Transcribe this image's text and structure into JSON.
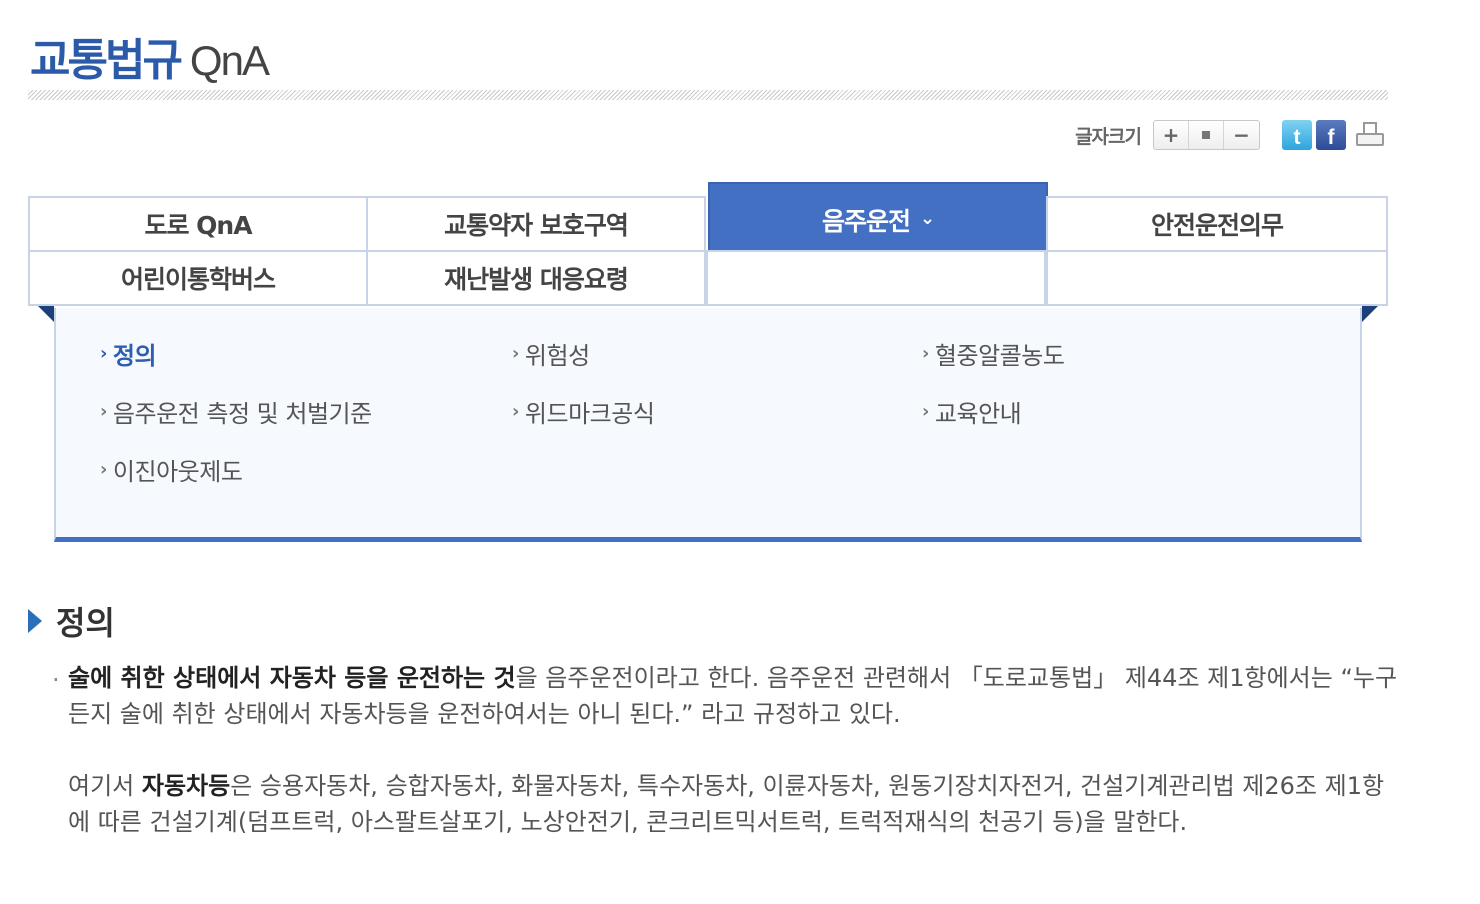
{
  "page": {
    "title_ko": "교통법규",
    "title_en": "QnA"
  },
  "tools": {
    "font_size_label": "글자크기",
    "font_plus": "+",
    "font_minus": "−",
    "twitter_glyph": "t",
    "facebook_glyph": "f",
    "icons": [
      "plus-icon",
      "reset-icon",
      "minus-icon",
      "twitter-icon",
      "facebook-icon",
      "print-icon"
    ]
  },
  "tabs": [
    {
      "label": "도로 QnA",
      "active": false
    },
    {
      "label": "교통약자 보호구역",
      "active": false
    },
    {
      "label": "음주운전",
      "active": true
    },
    {
      "label": "안전운전의무",
      "active": false
    },
    {
      "label": "어린이통학버스",
      "active": false
    },
    {
      "label": "재난발생 대응요령",
      "active": false
    }
  ],
  "active_tab_chevron": "⌄",
  "submenu": {
    "arrow": "›",
    "items": [
      {
        "label": "정의",
        "active": true
      },
      {
        "label": "위험성",
        "active": false
      },
      {
        "label": "혈중알콜농도",
        "active": false
      },
      {
        "label": "음주운전 측정 및 처벌기준",
        "active": false
      },
      {
        "label": "위드마크공식",
        "active": false
      },
      {
        "label": "교육안내",
        "active": false
      },
      {
        "label": "이진아웃제도",
        "active": false
      }
    ]
  },
  "section": {
    "heading": "정의",
    "p1_bold": "술에 취한 상태에서 자동차 등을 운전하는 것",
    "p1_rest": "을 음주운전이라고 한다. 음주운전 관련해서 「도로교통법」 제44조 제1항에서는 “누구든지 술에 취한 상태에서 자동차등을 운전하여서는 아니 된다.” 라고 규정하고 있다.",
    "p2_pre": "여기서 ",
    "p2_bold": "자동차등",
    "p2_rest": "은 승용자동차, 승합자동차, 화물자동차, 특수자동차, 이륜자동차, 원동기장치자전거, 건설기계관리법 제26조 제1항에 따른 건설기계(덤프트럭, 아스팔트살포기, 노상안전기, 콘크리트믹서트럭, 트럭적재식의 천공기 등)을 말한다."
  },
  "colors": {
    "accent": "#4470c4",
    "title_blue": "#2b5aa8",
    "tab_border": "#c7d3e6"
  }
}
